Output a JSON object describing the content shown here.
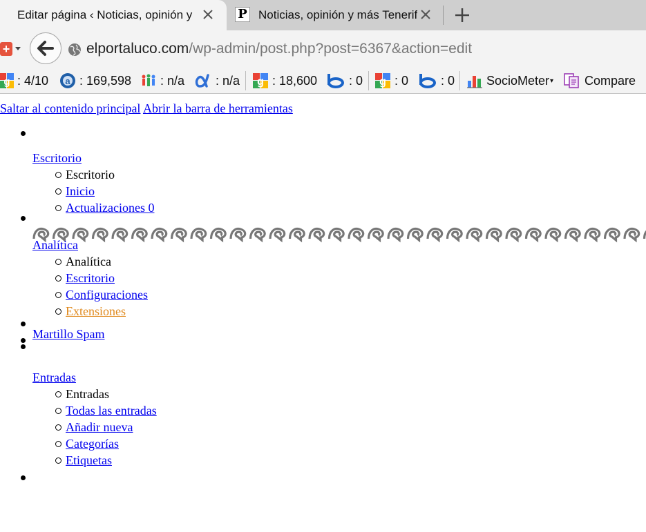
{
  "browser": {
    "tabs": [
      {
        "title": "Editar página ‹ Noticias, opinión y más Tenerife"
      },
      {
        "title": "Noticias, opinión y más Tenerife"
      }
    ],
    "address": {
      "host": "elportaluco.com",
      "path": "/wp-admin/post.php?post=6367&action=edit"
    },
    "seo_metrics": [
      {
        "icon": "google-pagerank-icon",
        "value": ": 4/10"
      },
      {
        "icon": "alexa-icon",
        "value": ": 169,598"
      },
      {
        "icon": "people-icon",
        "value": ": n/a"
      },
      {
        "icon": "alpha-icon",
        "value": ": n/a"
      },
      {
        "icon": "google-index-icon",
        "value": ": 18,600"
      },
      {
        "icon": "bing-icon",
        "value": ": 0"
      },
      {
        "icon": "google-backlinks-icon",
        "value": ": 0"
      },
      {
        "icon": "bing-backlinks-icon",
        "value": ": 0"
      }
    ],
    "sociometer_label": "SocioMeter",
    "compare_label": "Compare"
  },
  "page": {
    "skip_links": [
      "Saltar al contenido principal",
      "Abrir la barra de herramientas"
    ],
    "menu": [
      {
        "label": "Escritorio",
        "sub": [
          {
            "label": "Escritorio",
            "current": true
          },
          {
            "label": "Inicio"
          },
          {
            "label": "Actualizaciones 0"
          }
        ]
      },
      {
        "label": "Analítica",
        "sub": [
          {
            "label": "Analítica",
            "current": true
          },
          {
            "label": "Escritorio"
          },
          {
            "label": "Configuraciones"
          },
          {
            "label": "Extensiones",
            "highlight": true
          }
        ]
      },
      {
        "label": "Martillo Spam"
      },
      {
        "label": "Entradas",
        "sub": [
          {
            "label": "Entradas",
            "current": true
          },
          {
            "label": "Todas las entradas"
          },
          {
            "label": "Añadir nueva"
          },
          {
            "label": "Categorías"
          },
          {
            "label": "Etiquetas"
          }
        ]
      }
    ]
  },
  "colors": {
    "link": "#0000ee",
    "highlight": "#e08a1e",
    "chrome": "#f3f3f3",
    "tabstrip": "#cfcfcf"
  }
}
